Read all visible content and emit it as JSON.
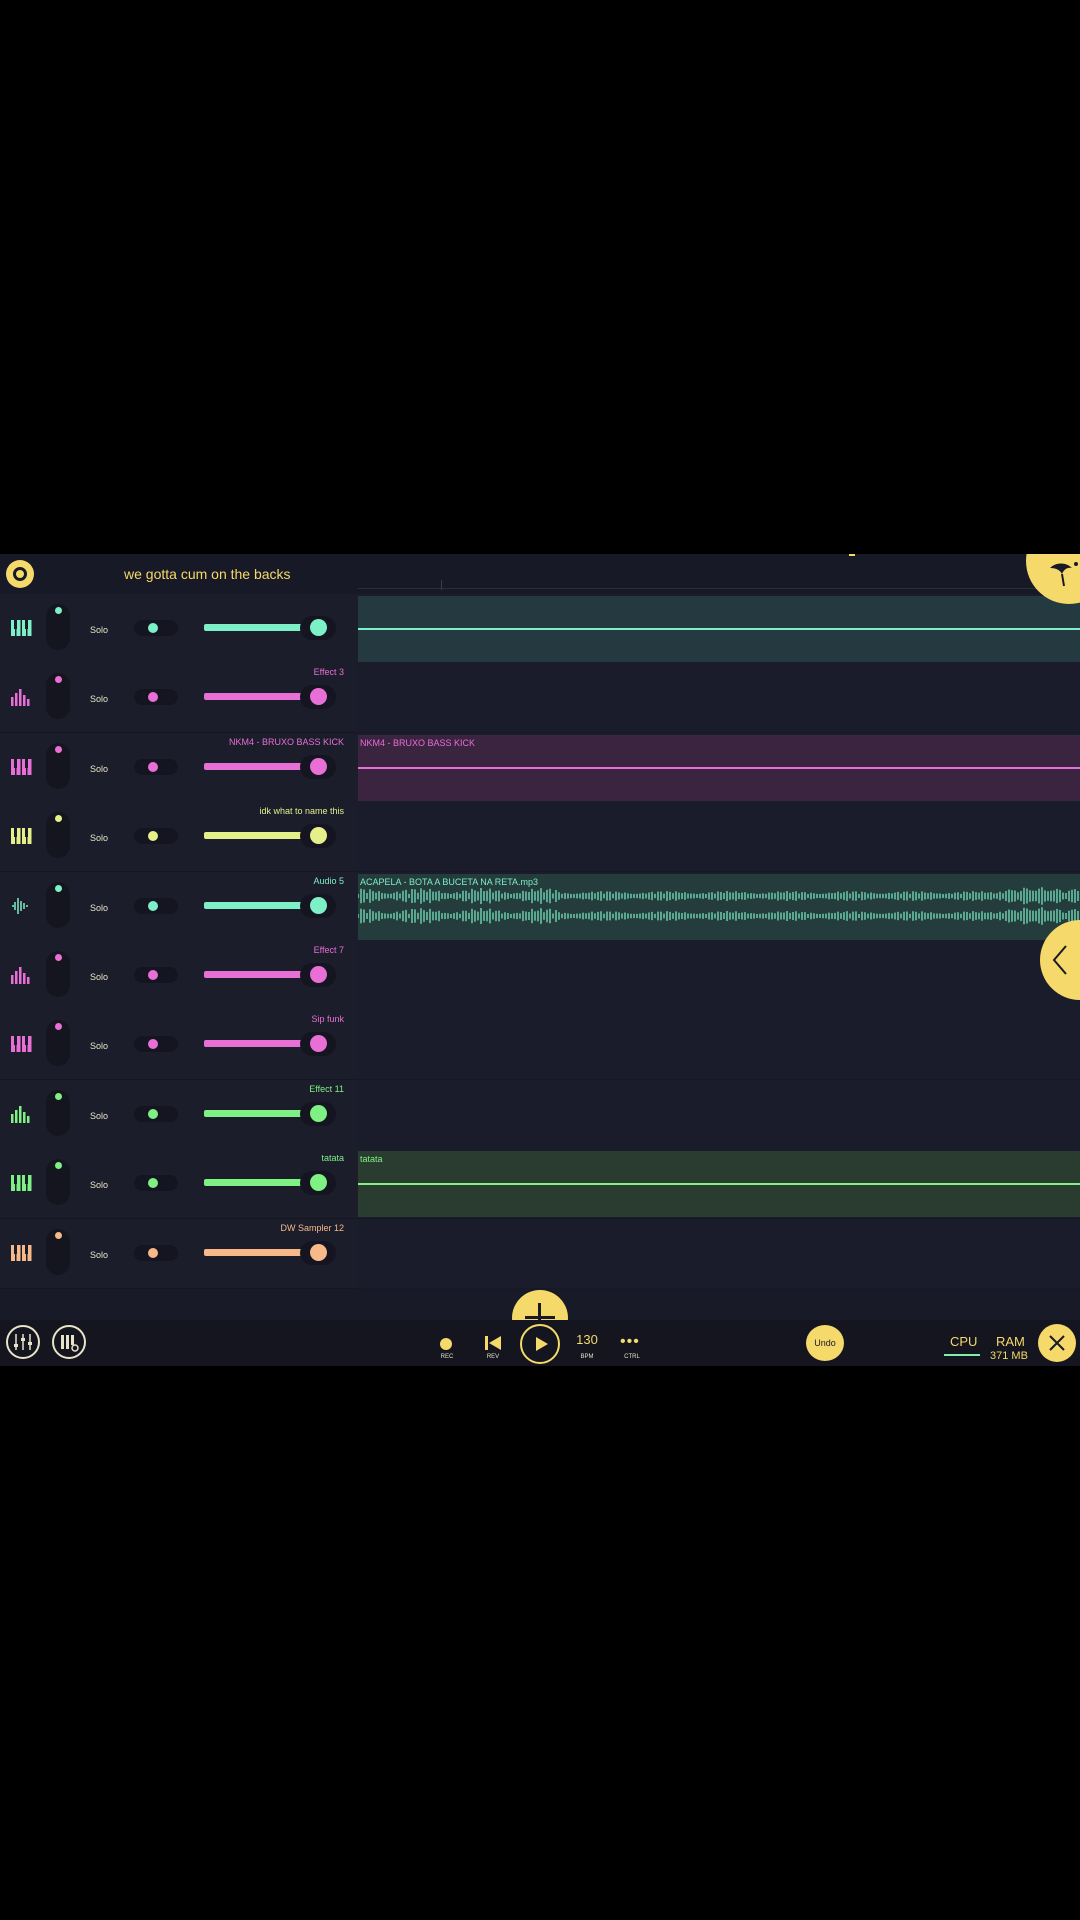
{
  "header": {
    "project_title": "we gotta cum on the backs"
  },
  "colors": {
    "accent": "#f5d96a",
    "teal": "#7df0c8",
    "pink": "#e86fd6",
    "lime": "#e6f08a",
    "green": "#7ef084",
    "peach": "#f7b98a"
  },
  "tracks": [
    {
      "name": "",
      "type": "instrument",
      "color": "#7df0c8",
      "solo": "Solo",
      "clip": {
        "name": "",
        "bg": "#243a40"
      }
    },
    {
      "name": "Effect 3",
      "type": "effect",
      "color": "#e86fd6",
      "solo": "Solo",
      "clip": null
    },
    {
      "name": "NKM4 - BRUXO BASS KICK",
      "type": "instrument",
      "color": "#e86fd6",
      "solo": "Solo",
      "clip": {
        "name": "NKM4 - BRUXO BASS KICK",
        "bg": "#3a2440"
      }
    },
    {
      "name": "idk what to name this",
      "type": "instrument",
      "color": "#e6f08a",
      "solo": "Solo",
      "clip": null
    },
    {
      "name": "Audio 5",
      "type": "audio",
      "color": "#7df0c8",
      "solo": "Solo",
      "clip": {
        "name": "ACAPELA - BOTA A BUCETA NA RETA.mp3",
        "bg": "#253c3c",
        "waveform": true
      }
    },
    {
      "name": "Effect 7",
      "type": "effect",
      "color": "#e86fd6",
      "solo": "Solo",
      "clip": null
    },
    {
      "name": "Sip funk",
      "type": "instrument",
      "color": "#e86fd6",
      "solo": "Solo",
      "clip": null
    },
    {
      "name": "Effect 11",
      "type": "effect",
      "color": "#7ef084",
      "solo": "Solo",
      "clip": null
    },
    {
      "name": "tatata",
      "type": "instrument",
      "color": "#7ef084",
      "solo": "Solo",
      "clip": {
        "name": "tatata",
        "bg": "#2a3c30"
      }
    },
    {
      "name": "DW Sampler 12",
      "type": "instrument",
      "color": "#f7b98a",
      "solo": "Solo",
      "clip": null
    }
  ],
  "transport": {
    "rec_label": "REC",
    "rev_label": "REV",
    "bpm_value": "130",
    "bpm_label": "BPM",
    "ctrl_label": "CTRL",
    "undo_label": "Undo"
  },
  "status": {
    "cpu_label": "CPU",
    "ram_label": "RAM",
    "ram_value": "371 MB"
  }
}
